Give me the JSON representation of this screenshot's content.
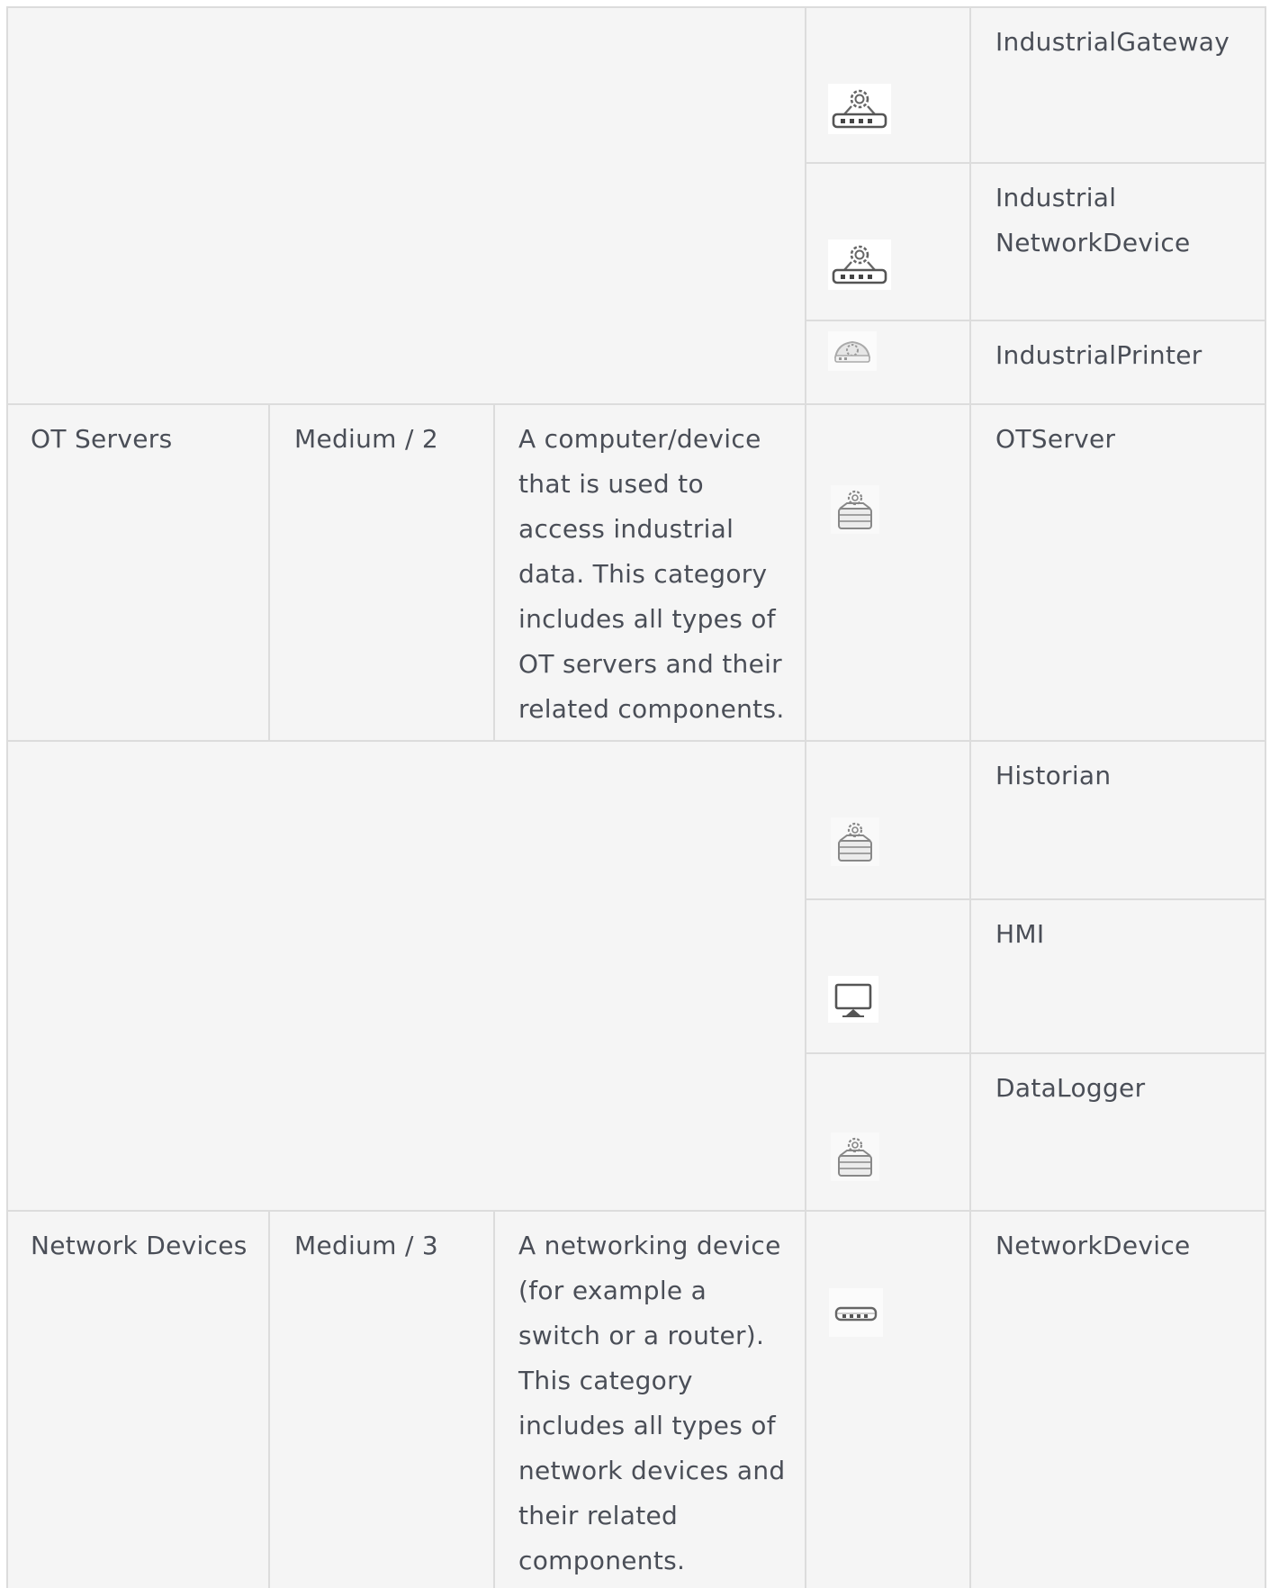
{
  "rows": {
    "industrial_gateway": {
      "name": "IndustrialGateway",
      "icon": "gear-router-icon"
    },
    "industrial_network_device": {
      "name": "Industrial\nNetworkDevice",
      "icon": "gear-router-icon"
    },
    "industrial_printer": {
      "name": "IndustrialPrinter",
      "icon": "industrial-printer-icon"
    },
    "ot_servers": {
      "category": "OT Servers",
      "level": "Medium / 2",
      "description": "A computer/device\nthat is used to\naccess industrial\ndata. This category\nincludes all types of\nOT servers and their\nrelated components.",
      "icon": "gear-server-icon",
      "name": "OTServer"
    },
    "historian": {
      "name": "Historian",
      "icon": "gear-server-icon"
    },
    "hmi": {
      "name": "HMI",
      "icon": "monitor-icon"
    },
    "data_logger": {
      "name": "DataLogger",
      "icon": "gear-server-icon"
    },
    "network_devices": {
      "category": "Network Devices",
      "level": "Medium / 3",
      "description": "A networking device\n(for example a\nswitch or a router).\nThis category\nincludes all types of\nnetwork devices and\ntheir related\ncomponents.",
      "icon": "network-switch-icon",
      "name": "NetworkDevice"
    }
  }
}
